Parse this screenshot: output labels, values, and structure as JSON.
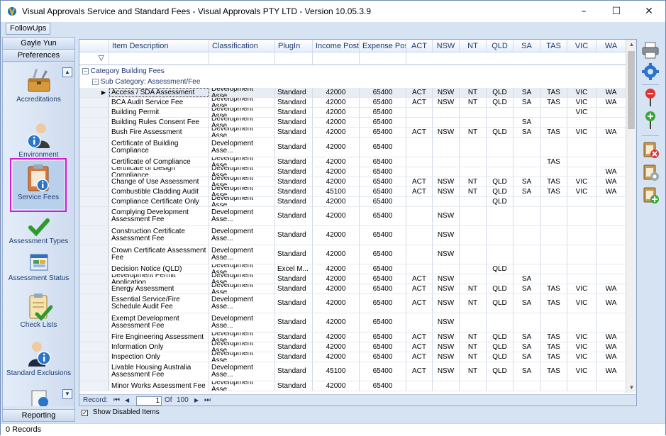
{
  "window": {
    "title": "Visual Approvals Service and Standard Fees - Visual Approvals PTY LTD - Version 10.05.3.9",
    "controls": [
      "–",
      "☐",
      "✕"
    ]
  },
  "toolbar": {
    "followups_label": "FollowUps"
  },
  "left_panel": {
    "user": "Gayle Yun",
    "section": "Preferences",
    "footer": "Reporting",
    "items": [
      {
        "label": "Accreditations",
        "icon": "toolbox-icon"
      },
      {
        "label": "Environment",
        "icon": "person-info-icon"
      },
      {
        "label": "Service Fees",
        "icon": "clipboard-info-icon",
        "selected": true
      },
      {
        "label": "Assessment Types",
        "icon": "checkmark-icon"
      },
      {
        "label": "Assessment Status",
        "icon": "status-window-icon"
      },
      {
        "label": "Check Lists",
        "icon": "checklist-icon"
      },
      {
        "label": "Standard Exclusions",
        "icon": "person-info-icon"
      }
    ],
    "scroll_up": "▲",
    "scroll_down": "▼"
  },
  "grid": {
    "columns": [
      "Item Description",
      "Classification",
      "PlugIn",
      "Income Post",
      "Expense Post",
      "ACT",
      "NSW",
      "NT",
      "QLD",
      "SA",
      "TAS",
      "VIC",
      "WA"
    ],
    "filter_icon": "▽",
    "group_label": "Category",
    "group_value": "Building Fees",
    "subgroup_label": "Sub Category:",
    "subgroup_value": "Assessment/Fee",
    "expand_glyph": "−",
    "active_marker": "▶",
    "rows": [
      {
        "desc": "Access / SDA Assessment",
        "class": "Development Asse...",
        "plugin": "Standard",
        "income": "42000",
        "expense": "65400",
        "act": "ACT",
        "nsw": "NSW",
        "nt": "NT",
        "qld": "QLD",
        "sa": "SA",
        "tas": "TAS",
        "vic": "VIC",
        "wa": "WA"
      },
      {
        "desc": "BCA Audit Service Fee",
        "class": "Development Asse...",
        "plugin": "Standard",
        "income": "42000",
        "expense": "65400",
        "act": "ACT",
        "nsw": "NSW",
        "nt": "NT",
        "qld": "QLD",
        "sa": "SA",
        "tas": "TAS",
        "vic": "VIC",
        "wa": "WA"
      },
      {
        "desc": "Building Permit",
        "class": "Development Asse...",
        "plugin": "Standard",
        "income": "42000",
        "expense": "65400",
        "act": "",
        "nsw": "",
        "nt": "",
        "qld": "",
        "sa": "",
        "tas": "",
        "vic": "VIC",
        "wa": ""
      },
      {
        "desc": "Building Rules Consent Fee",
        "class": "Development Asse...",
        "plugin": "Standard",
        "income": "42000",
        "expense": "65400",
        "act": "",
        "nsw": "",
        "nt": "",
        "qld": "",
        "sa": "SA",
        "tas": "",
        "vic": "",
        "wa": ""
      },
      {
        "desc": "Bush Fire Assessment",
        "class": "Development Asse...",
        "plugin": "Standard",
        "income": "42000",
        "expense": "65400",
        "act": "ACT",
        "nsw": "NSW",
        "nt": "NT",
        "qld": "QLD",
        "sa": "SA",
        "tas": "TAS",
        "vic": "VIC",
        "wa": "WA"
      },
      {
        "desc": "Certificate of Building Compliance",
        "class": "Development Asse...",
        "plugin": "Standard",
        "income": "42000",
        "expense": "65400",
        "act": "",
        "nsw": "",
        "nt": "",
        "qld": "",
        "sa": "",
        "tas": "",
        "vic": "",
        "wa": ""
      },
      {
        "desc": "Certificate of Compliance",
        "class": "Development Asse...",
        "plugin": "Standard",
        "income": "42000",
        "expense": "65400",
        "act": "",
        "nsw": "",
        "nt": "",
        "qld": "",
        "sa": "",
        "tas": "TAS",
        "vic": "",
        "wa": ""
      },
      {
        "desc": "Certificate of Design Compliance",
        "class": "Development Asse...",
        "plugin": "Standard",
        "income": "42000",
        "expense": "65400",
        "act": "",
        "nsw": "",
        "nt": "",
        "qld": "",
        "sa": "",
        "tas": "",
        "vic": "",
        "wa": "WA"
      },
      {
        "desc": "Change of Use Assessment",
        "class": "Development Asse...",
        "plugin": "Standard",
        "income": "42000",
        "expense": "65400",
        "act": "ACT",
        "nsw": "NSW",
        "nt": "NT",
        "qld": "QLD",
        "sa": "SA",
        "tas": "TAS",
        "vic": "VIC",
        "wa": "WA"
      },
      {
        "desc": "Combustible Cladding Audit",
        "class": "Development Asse...",
        "plugin": "Standard",
        "income": "45100",
        "expense": "65400",
        "act": "ACT",
        "nsw": "NSW",
        "nt": "NT",
        "qld": "QLD",
        "sa": "SA",
        "tas": "TAS",
        "vic": "VIC",
        "wa": "WA"
      },
      {
        "desc": "Compliance Certificate Only",
        "class": "Development Asse...",
        "plugin": "Standard",
        "income": "42000",
        "expense": "65400",
        "act": "",
        "nsw": "",
        "nt": "",
        "qld": "QLD",
        "sa": "",
        "tas": "",
        "vic": "",
        "wa": ""
      },
      {
        "desc": "Complying Development Assessment Fee",
        "class": "Development Asse...",
        "plugin": "Standard",
        "income": "42000",
        "expense": "65400",
        "act": "",
        "nsw": "NSW",
        "nt": "",
        "qld": "",
        "sa": "",
        "tas": "",
        "vic": "",
        "wa": ""
      },
      {
        "desc": "Construction Certificate Assessment Fee",
        "class": "Development Asse...",
        "plugin": "Standard",
        "income": "42000",
        "expense": "65400",
        "act": "",
        "nsw": "NSW",
        "nt": "",
        "qld": "",
        "sa": "",
        "tas": "",
        "vic": "",
        "wa": ""
      },
      {
        "desc": "Crown Certificate Assessment Fee",
        "class": "Development Asse...",
        "plugin": "Standard",
        "income": "42000",
        "expense": "65400",
        "act": "",
        "nsw": "NSW",
        "nt": "",
        "qld": "",
        "sa": "",
        "tas": "",
        "vic": "",
        "wa": ""
      },
      {
        "desc": "Decision Notice (QLD)",
        "class": "Development Asse...",
        "plugin": "Excel M...",
        "income": "42000",
        "expense": "65400",
        "act": "",
        "nsw": "",
        "nt": "",
        "qld": "QLD",
        "sa": "",
        "tas": "",
        "vic": "",
        "wa": ""
      },
      {
        "desc": "Development Permit Application",
        "class": "Development Asse...",
        "plugin": "Standard",
        "income": "42000",
        "expense": "65400",
        "act": "ACT",
        "nsw": "NSW",
        "nt": "",
        "qld": "",
        "sa": "SA",
        "tas": "",
        "vic": "",
        "wa": ""
      },
      {
        "desc": "Energy Assessment",
        "class": "Development Asse...",
        "plugin": "Standard",
        "income": "42000",
        "expense": "65400",
        "act": "ACT",
        "nsw": "NSW",
        "nt": "NT",
        "qld": "QLD",
        "sa": "SA",
        "tas": "TAS",
        "vic": "VIC",
        "wa": "WA"
      },
      {
        "desc": "Essential Service/Fire Schedule Audit Fee",
        "class": "Development Asse...",
        "plugin": "Standard",
        "income": "42000",
        "expense": "65400",
        "act": "ACT",
        "nsw": "NSW",
        "nt": "NT",
        "qld": "QLD",
        "sa": "SA",
        "tas": "TAS",
        "vic": "VIC",
        "wa": "WA"
      },
      {
        "desc": "Exempt Development Assessment Fee",
        "class": "Development Asse...",
        "plugin": "Standard",
        "income": "42000",
        "expense": "65400",
        "act": "",
        "nsw": "NSW",
        "nt": "",
        "qld": "",
        "sa": "",
        "tas": "",
        "vic": "",
        "wa": ""
      },
      {
        "desc": "Fire Engineering Assessment",
        "class": "Development Asse...",
        "plugin": "Standard",
        "income": "42000",
        "expense": "65400",
        "act": "ACT",
        "nsw": "NSW",
        "nt": "NT",
        "qld": "QLD",
        "sa": "SA",
        "tas": "TAS",
        "vic": "VIC",
        "wa": "WA"
      },
      {
        "desc": "Information Only",
        "class": "Development Asse...",
        "plugin": "Standard",
        "income": "42000",
        "expense": "65400",
        "act": "ACT",
        "nsw": "NSW",
        "nt": "NT",
        "qld": "QLD",
        "sa": "SA",
        "tas": "TAS",
        "vic": "VIC",
        "wa": "WA"
      },
      {
        "desc": "Inspection Only",
        "class": "Development Asse...",
        "plugin": "Standard",
        "income": "42000",
        "expense": "65400",
        "act": "ACT",
        "nsw": "NSW",
        "nt": "NT",
        "qld": "QLD",
        "sa": "SA",
        "tas": "TAS",
        "vic": "VIC",
        "wa": "WA"
      },
      {
        "desc": "Livable Housing Australia Assessment Fee",
        "class": "Development Asse...",
        "plugin": "Standard",
        "income": "45100",
        "expense": "65400",
        "act": "ACT",
        "nsw": "NSW",
        "nt": "NT",
        "qld": "QLD",
        "sa": "SA",
        "tas": "TAS",
        "vic": "VIC",
        "wa": "WA"
      },
      {
        "desc": "Minor Works Assessment Fee",
        "class": "Development Asse...",
        "plugin": "Standard",
        "income": "42000",
        "expense": "65400",
        "act": "",
        "nsw": "",
        "nt": "",
        "qld": "",
        "sa": "",
        "tas": "",
        "vic": "",
        "wa": ""
      }
    ]
  },
  "navigator": {
    "record_label": "Record:",
    "first": "⏮",
    "prev": "◀",
    "current": "1",
    "of_label": "Of",
    "total": "100",
    "next": "▶",
    "last": "⏭"
  },
  "show_disabled": {
    "label": "Show Disabled Items",
    "checked": true
  },
  "status": {
    "records": "0 Records"
  },
  "right_toolbar": [
    "printer-icon",
    "settings-gear-icon",
    "remove-red-icon",
    "add-green-icon",
    "delete-clipboard-icon",
    "copy-clipboard-icon",
    "add-clipboard-icon"
  ]
}
